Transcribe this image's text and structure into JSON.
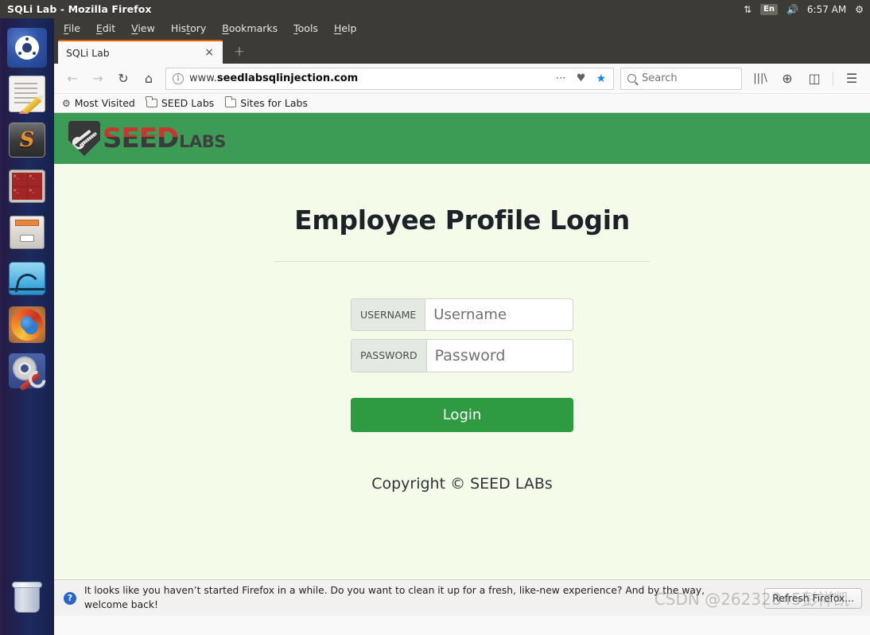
{
  "desktop": {
    "panel_title": "SQLi Lab - Mozilla Firefox",
    "tray": {
      "network_icon": "network-updown-icon",
      "keyboard_layout": "En",
      "volume_icon": "volume-icon",
      "clock": "6:57 AM",
      "settings_icon": "system-gear-icon"
    },
    "launcher": [
      {
        "name": "ubuntu-dash",
        "label": "Ubuntu Dash"
      },
      {
        "name": "text-editor",
        "label": "Text Editor"
      },
      {
        "name": "sublime-text",
        "label": "S"
      },
      {
        "name": "terminal",
        "label": "Terminal"
      },
      {
        "name": "files",
        "label": "Files"
      },
      {
        "name": "wireshark",
        "label": "Wireshark"
      },
      {
        "name": "firefox",
        "label": "Firefox"
      },
      {
        "name": "system-settings",
        "label": "System Settings"
      },
      {
        "name": "trash",
        "label": "Trash"
      }
    ]
  },
  "browser": {
    "menus": [
      {
        "pre": "",
        "accel": "F",
        "post": "ile"
      },
      {
        "pre": "",
        "accel": "E",
        "post": "dit"
      },
      {
        "pre": "",
        "accel": "V",
        "post": "iew"
      },
      {
        "pre": "His",
        "accel": "t",
        "post": "ory"
      },
      {
        "pre": "",
        "accel": "B",
        "post": "ookmarks"
      },
      {
        "pre": "",
        "accel": "T",
        "post": "ools"
      },
      {
        "pre": "",
        "accel": "H",
        "post": "elp"
      }
    ],
    "tab": {
      "title": "SQLi Lab",
      "close_label": "×",
      "newtab_label": "+"
    },
    "nav": {
      "back_label": "←",
      "forward_label": "→",
      "reload_label": "↻",
      "home_label": "⌂",
      "info_label": "i",
      "url_prefix": "www.",
      "url_host": "seedlabsqlinjection.com",
      "page_actions_label": "⋯",
      "pocket_label": "♥",
      "bookmark_star_label": "★",
      "library_label": "|||\\",
      "account_label": "⊕",
      "sidebar_label": "◫",
      "menu_label": "☰"
    },
    "search": {
      "placeholder": "Search"
    },
    "bookmarks": [
      {
        "icon": "gear-icon",
        "label": "Most Visited"
      },
      {
        "icon": "folder-icon",
        "label": "SEED Labs"
      },
      {
        "icon": "folder-icon",
        "label": "Sites for Labs"
      }
    ],
    "notification": {
      "icon": "help-question-icon",
      "text": "It looks like you haven’t started Firefox in a while. Do you want to clean it up for a fresh, like-new experience? And by the way, welcome back!",
      "button_label": "Refresh Firefox..."
    },
    "watermark": "CSDN @26232845彭祥凯"
  },
  "page": {
    "logo": {
      "seed": "SEED",
      "labs": "LABS"
    },
    "title": "Employee Profile Login",
    "form": {
      "username": {
        "addon": "USERNAME",
        "placeholder": "Username",
        "value": ""
      },
      "password": {
        "addon": "PASSWORD",
        "placeholder": "Password",
        "value": ""
      },
      "submit_label": "Login"
    },
    "copyright": "Copyright © SEED LABs",
    "colors": {
      "header_green": "#3c9c55",
      "page_background": "#f4fbe8",
      "button_green": "#2e9b42",
      "accent_orange": "#e66000"
    }
  }
}
